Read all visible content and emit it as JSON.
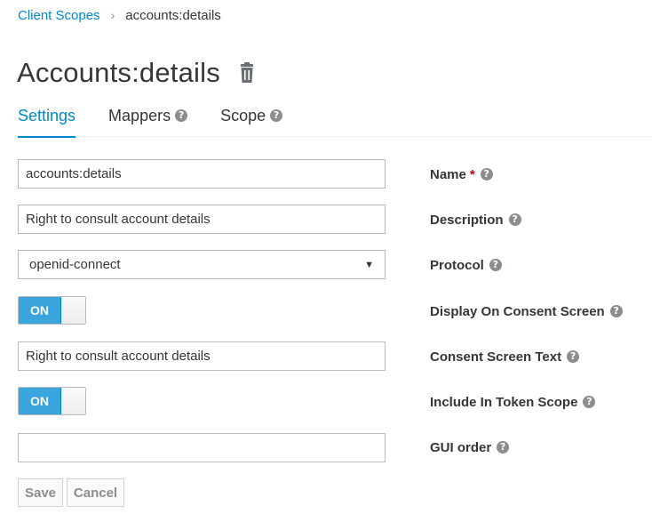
{
  "breadcrumb": {
    "parent": "Client Scopes",
    "separator": "›",
    "current": "accounts:details"
  },
  "header": {
    "title": "Accounts:details",
    "delete_icon": "trash-icon"
  },
  "tabs": [
    {
      "label": "Settings",
      "active": true,
      "help": false
    },
    {
      "label": "Mappers",
      "active": false,
      "help": true
    },
    {
      "label": "Scope",
      "active": false,
      "help": true
    }
  ],
  "help_glyph": "?",
  "form": {
    "name": {
      "label": "Name",
      "value": "accounts:details",
      "required_mark": "*"
    },
    "description": {
      "label": "Description",
      "value": "Right to consult account details"
    },
    "protocol": {
      "label": "Protocol",
      "value": "openid-connect",
      "caret": "▼"
    },
    "display_on_consent": {
      "label": "Display On Consent Screen",
      "state": "ON"
    },
    "consent_text": {
      "label": "Consent Screen Text",
      "value": "Right to consult account details"
    },
    "include_in_token": {
      "label": "Include In Token Scope",
      "state": "ON"
    },
    "gui_order": {
      "label": "GUI order",
      "value": ""
    }
  },
  "actions": {
    "save": "Save",
    "cancel": "Cancel"
  },
  "colors": {
    "accent": "#0088ce",
    "toggle_on": "#39a5dc",
    "required": "#cc0000",
    "help_icon": "#8b8d8f"
  }
}
